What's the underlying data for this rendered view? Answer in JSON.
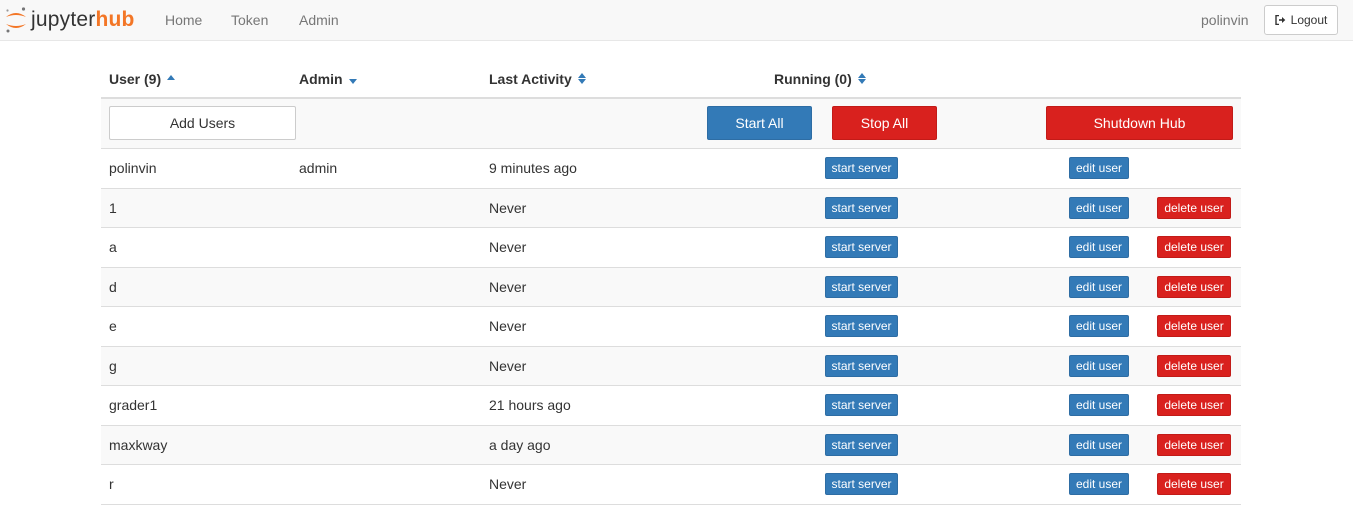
{
  "navbar": {
    "brand_prefix": "jupyter",
    "brand_suffix": "hub",
    "links": {
      "home": "Home",
      "token": "Token",
      "admin": "Admin"
    },
    "username": "polinvin",
    "logout_label": "Logout",
    "logout_icon": "sign-out-icon"
  },
  "table": {
    "headers": {
      "user": "User (9)",
      "admin": "Admin",
      "last_activity": "Last Activity",
      "running": "Running (0)"
    },
    "actions": {
      "add_users": "Add Users",
      "start_all": "Start All",
      "stop_all": "Stop All",
      "shutdown_hub": "Shutdown Hub"
    },
    "row_buttons": {
      "start": "start server",
      "edit": "edit user",
      "delete": "delete user"
    },
    "users": [
      {
        "name": "polinvin",
        "admin": "admin",
        "last_activity": "9 minutes ago",
        "deletable": false
      },
      {
        "name": "1",
        "admin": "",
        "last_activity": "Never",
        "deletable": true
      },
      {
        "name": "a",
        "admin": "",
        "last_activity": "Never",
        "deletable": true
      },
      {
        "name": "d",
        "admin": "",
        "last_activity": "Never",
        "deletable": true
      },
      {
        "name": "e",
        "admin": "",
        "last_activity": "Never",
        "deletable": true
      },
      {
        "name": "g",
        "admin": "",
        "last_activity": "Never",
        "deletable": true
      },
      {
        "name": "grader1",
        "admin": "",
        "last_activity": "21 hours ago",
        "deletable": true
      },
      {
        "name": "maxkway",
        "admin": "",
        "last_activity": "a day ago",
        "deletable": true
      },
      {
        "name": "r",
        "admin": "",
        "last_activity": "Never",
        "deletable": true
      }
    ]
  },
  "colors": {
    "primary": "#337ab7",
    "danger": "#d9211e",
    "brand_orange": "#f37626"
  }
}
